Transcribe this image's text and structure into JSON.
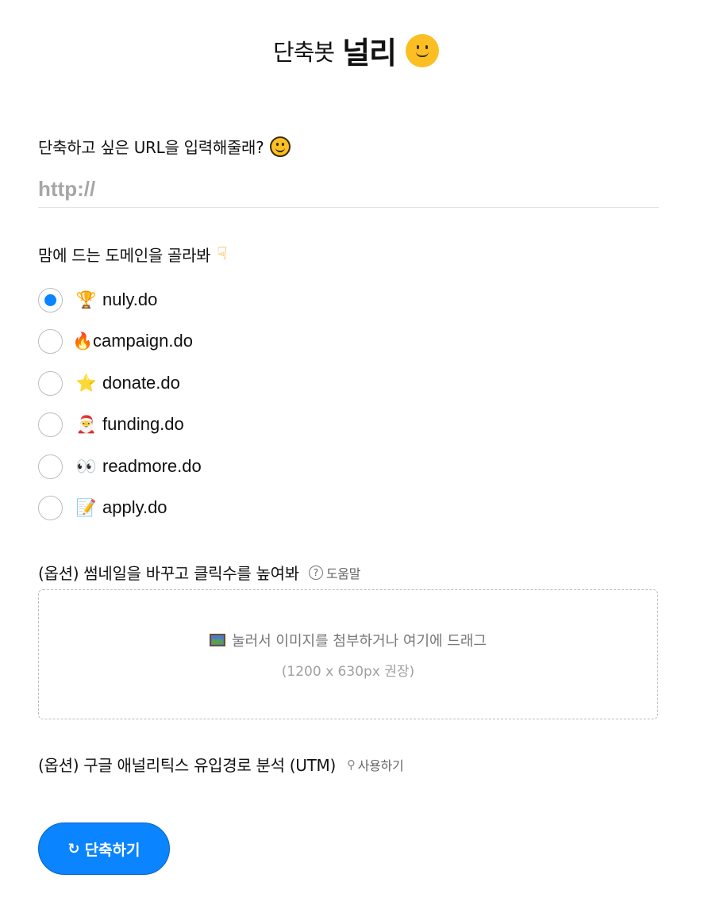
{
  "header": {
    "subtitle": "단축봇",
    "title": "널리",
    "emoji_icon": "smiley-face-icon"
  },
  "url_section": {
    "label": "단축하고 싶은 URL을 입력해줄래?",
    "label_icon": "smiley-face-icon",
    "input_placeholder": "http://",
    "input_value": ""
  },
  "domain_section": {
    "label": "맘에 드는 도메인을 골라봐",
    "label_icon": "pointing-down-hand-icon",
    "options": [
      {
        "emoji": "🏆",
        "icon": "trophy-icon",
        "domain": "nuly.do",
        "selected": true
      },
      {
        "emoji": "🔥",
        "icon": "fire-icon",
        "domain": "campaign.do",
        "selected": false
      },
      {
        "emoji": "⭐",
        "icon": "star-icon",
        "domain": "donate.do",
        "selected": false
      },
      {
        "emoji": "🎅",
        "icon": "santa-icon",
        "domain": "funding.do",
        "selected": false
      },
      {
        "emoji": "👀",
        "icon": "eyes-icon",
        "domain": "readmore.do",
        "selected": false
      },
      {
        "emoji": "📝",
        "icon": "memo-icon",
        "domain": "apply.do",
        "selected": false
      }
    ]
  },
  "thumbnail_section": {
    "label": "(옵션) 썸네일을 바꾸고 클릭수를 높여봐",
    "help_label": "도움말",
    "help_icon": "question-circle-icon",
    "dropzone_text": "눌러서 이미지를 첨부하거나 여기에 드래그",
    "dropzone_icon": "framed-picture-icon",
    "dropzone_hint": "(1200 x 630px 권장)"
  },
  "utm_section": {
    "label": "(옵션) 구글 애널리틱스 유입경로 분석 (UTM)",
    "action_label": "사용하기",
    "action_icon": "magic-wand-icon"
  },
  "submit": {
    "label": "단축하기",
    "icon": "refresh-icon"
  },
  "colors": {
    "accent": "#0a84ff",
    "smiley": "#fbbf24",
    "text": "#111111",
    "muted": "#777777"
  }
}
